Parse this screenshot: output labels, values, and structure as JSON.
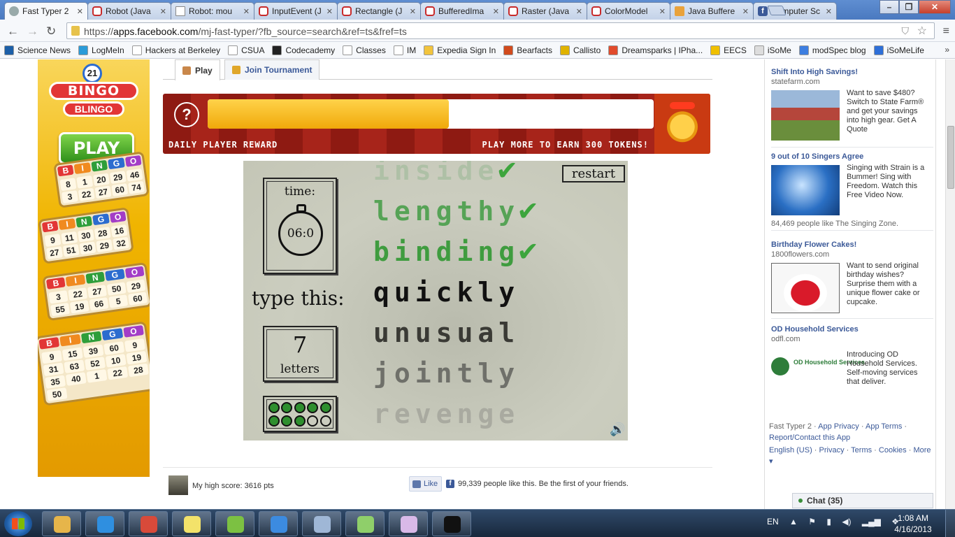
{
  "browser": {
    "tabs": [
      {
        "label": "Fast Typer 2",
        "icon": "gray"
      },
      {
        "label": "Robot (Java",
        "icon": "or"
      },
      {
        "label": "Robot: mou",
        "icon": "doc"
      },
      {
        "label": "InputEvent (J",
        "icon": "or"
      },
      {
        "label": "Rectangle (J",
        "icon": "or"
      },
      {
        "label": "BufferedIma",
        "icon": "or"
      },
      {
        "label": "Raster (Java",
        "icon": "or"
      },
      {
        "label": "ColorModel",
        "icon": "or"
      },
      {
        "label": "Java Buffere",
        "icon": "jv"
      },
      {
        "label": "Computer Sc",
        "icon": "fb"
      }
    ],
    "url_prefix": "https://",
    "url_host": "apps.facebook.com",
    "url_rest": "/mj-fast-typer/?fb_source=search&ref=ts&fref=ts",
    "bookmarks": [
      {
        "label": "Science News",
        "color": "#1c5fa8"
      },
      {
        "label": "LogMeIn",
        "color": "#2a9bd8"
      },
      {
        "label": "Hackers at Berkeley",
        "color": "#ffffff"
      },
      {
        "label": "CSUA",
        "color": "#ffffff"
      },
      {
        "label": "Codecademy",
        "color": "#222222"
      },
      {
        "label": "Classes",
        "color": "#ffffff"
      },
      {
        "label": "IM",
        "color": "#ffffff"
      },
      {
        "label": "Expedia Sign In",
        "color": "#f2c43d"
      },
      {
        "label": "Bearfacts",
        "color": "#d14a1d"
      },
      {
        "label": "Callisto",
        "color": "#e0b300"
      },
      {
        "label": "Dreamsparks | IPha...",
        "color": "#e14b2c"
      },
      {
        "label": "EECS",
        "color": "#f0c000"
      },
      {
        "label": "iSoMe",
        "color": "#dddddd"
      },
      {
        "label": "modSpec blog",
        "color": "#3d7ee0"
      },
      {
        "label": "iSoMeLife",
        "color": "#2e6fd8"
      }
    ],
    "bookmarks_more": "»"
  },
  "app": {
    "tab_play": "Play",
    "tab_tournament": "Join Tournament",
    "bingo": {
      "ball_number": "21",
      "logo_top": "BINGO",
      "logo_bottom": "BLINGO",
      "play_button": "PLAY",
      "card_header": [
        "B",
        "I",
        "N",
        "G",
        "O"
      ],
      "card_header_colors": [
        "#e23636",
        "#f08a1f",
        "#2e9e3a",
        "#2c6ccf",
        "#a33dc7"
      ],
      "cards": [
        {
          "numbers": [
            "8",
            "1",
            "20",
            "29",
            "46",
            "3",
            "22",
            "27",
            "60",
            "74"
          ]
        },
        {
          "numbers": [
            "9",
            "11",
            "30",
            "28",
            "16",
            "27",
            "51",
            "30",
            "29",
            "32"
          ]
        },
        {
          "numbers": [
            "3",
            "22",
            "27",
            "50",
            "29",
            "55",
            "19",
            "66",
            "5",
            "60"
          ]
        },
        {
          "numbers": [
            "9",
            "15",
            "39",
            "60",
            "9",
            "31",
            "63",
            "52",
            "10",
            "19",
            "35",
            "40",
            "1",
            "22",
            "28",
            "50"
          ]
        }
      ]
    },
    "reward": {
      "question": "?",
      "progress": 0.54,
      "label_left": "DAILY PLAYER REWARD",
      "label_right": "PLAY MORE TO EARN 300 TOKENS!"
    },
    "game": {
      "restart": "restart",
      "time_label": "time:",
      "time_value": "06:0",
      "type_this": "type this:",
      "letters_count": "7",
      "letters_label": "letters",
      "dots": [
        true,
        true,
        true,
        true,
        true,
        true,
        true,
        true,
        false,
        false
      ],
      "words": [
        {
          "text": "inside",
          "check": "✔",
          "color": "#aec0a6"
        },
        {
          "text": "lengthy",
          "check": "✔",
          "color": "#56a356"
        },
        {
          "text": "binding",
          "check": "✔",
          "color": "#3f9c3f"
        },
        {
          "text": "quickly",
          "check": "",
          "color": "#111111"
        },
        {
          "text": "unusual",
          "check": "",
          "color": "#3a3a35"
        },
        {
          "text": "jointly",
          "check": "",
          "color": "#6f706a"
        },
        {
          "text": "revenge",
          "check": "",
          "color": "#a9aaa0"
        }
      ],
      "sound_icon": "🔊"
    },
    "high_score": "My high score: 3616 pts",
    "like_button": "Like",
    "like_text": "99,339 people like this. Be the first of your friends."
  },
  "ads": [
    {
      "title": "Shift Into High Savings!",
      "site": "statefarm.com",
      "body": "Want to save $480? Switch to State Farm® and get your savings into high gear. Get A Quote",
      "social": ""
    },
    {
      "title": "9 out of 10 Singers Agree",
      "site": "",
      "body": "Singing with Strain is a Bummer! Sing with Freedom. Watch this Free Video Now.",
      "social": "84,469 people like The Singing Zone."
    },
    {
      "title": "Birthday Flower Cakes!",
      "site": "1800flowers.com",
      "body": "Want to send original birthday wishes? Surprise them with a unique flower cake or cupcake.",
      "social": ""
    },
    {
      "title": "OD Household Services",
      "site": "odfl.com",
      "body": "Introducing OD Household Services. Self-moving services that deliver.",
      "social": ""
    }
  ],
  "ad_logo_texts": {
    "statefarm": "State Farm",
    "od": "OD Household Services",
    "od_tag": "Self-moving services that deliver"
  },
  "footer": {
    "app_name": "Fast Typer 2",
    "app_privacy": "App Privacy",
    "app_terms": "App Terms",
    "report": "Report/Contact this App",
    "language": "English (US)",
    "privacy": "Privacy",
    "terms": "Terms",
    "cookies": "Cookies",
    "more": "More ▾"
  },
  "chat": "Chat (35)",
  "taskbar": {
    "apps": [
      {
        "name": "explorer",
        "color": "#e6b54a"
      },
      {
        "name": "ie",
        "color": "#2f8fe0"
      },
      {
        "name": "chrome",
        "color": "#d84a3a"
      },
      {
        "name": "sticky-notes",
        "color": "#f3e26a"
      },
      {
        "name": "spotify",
        "color": "#7cc142"
      },
      {
        "name": "itunes",
        "color": "#3c8be0"
      },
      {
        "name": "network",
        "color": "#9fb7d6"
      },
      {
        "name": "notepad-plus",
        "color": "#8fcf6a"
      },
      {
        "name": "paint",
        "color": "#d9b9e8"
      },
      {
        "name": "cmd",
        "color": "#111111"
      }
    ],
    "language": "EN",
    "time": "1:08 AM",
    "date": "4/16/2013"
  }
}
